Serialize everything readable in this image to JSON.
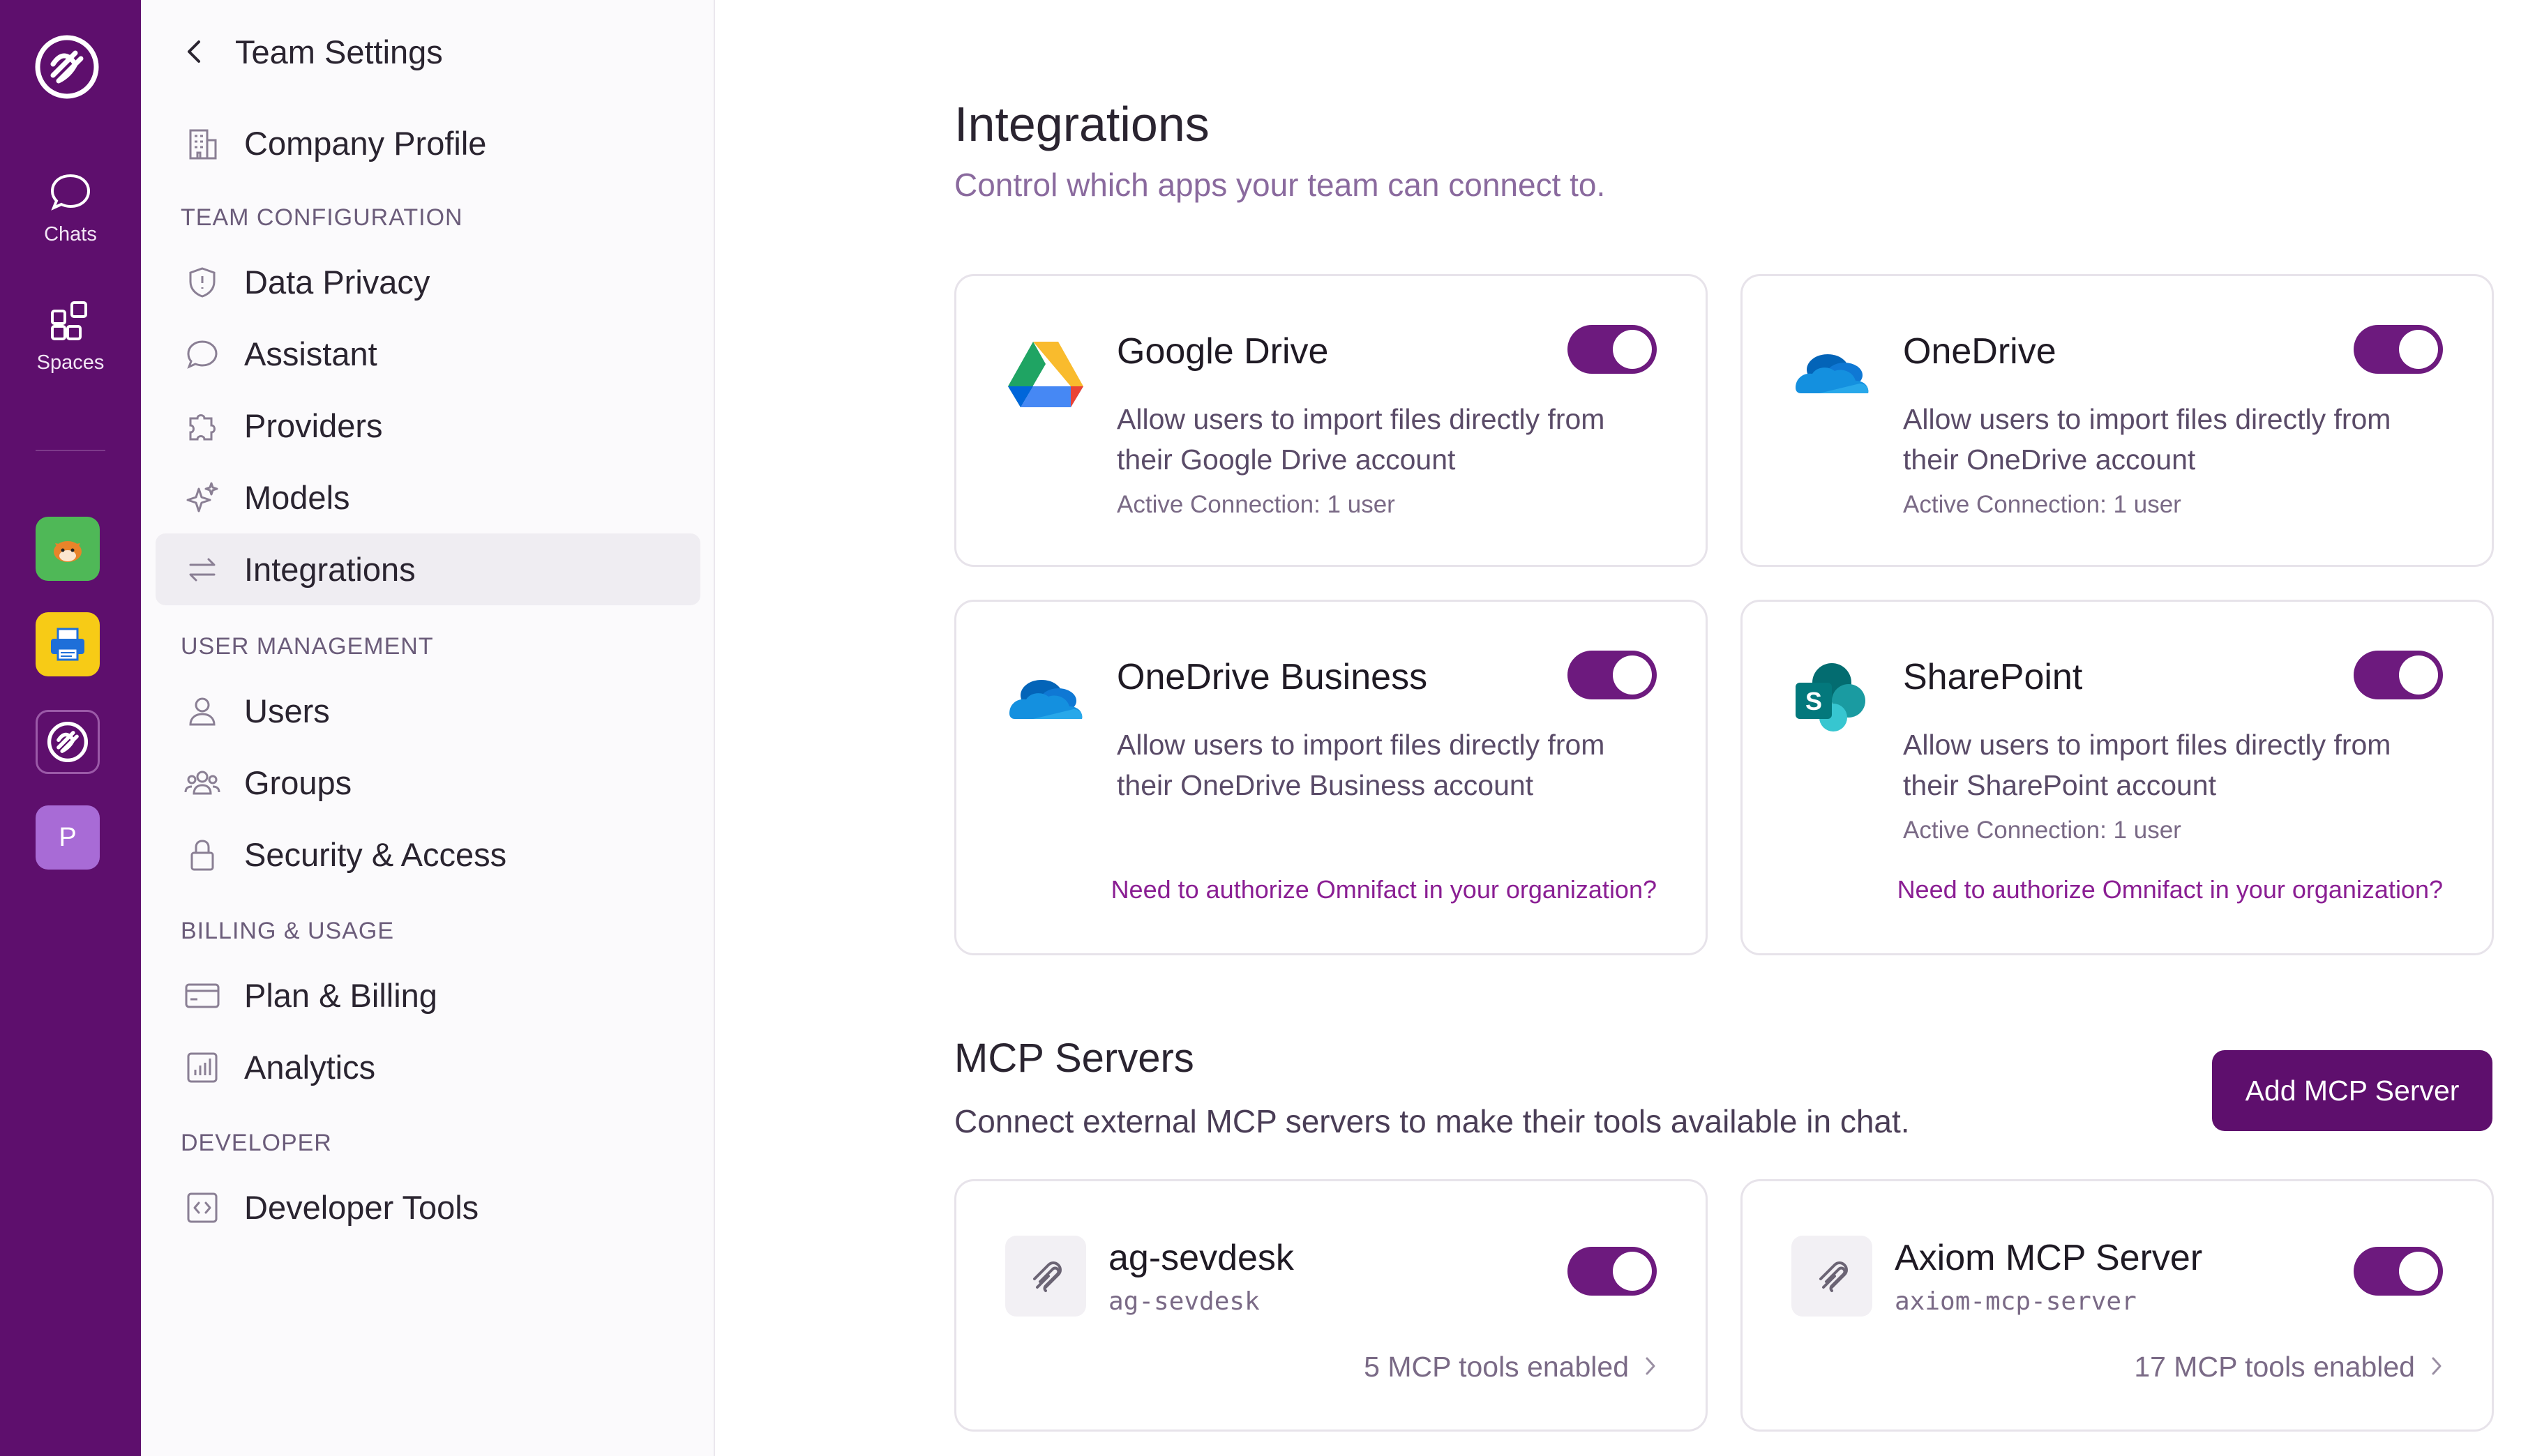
{
  "rail": {
    "items": [
      {
        "label": "Chats",
        "icon": "chat-bubble-icon"
      },
      {
        "label": "Spaces",
        "icon": "spaces-grid-icon"
      }
    ],
    "apps": [
      {
        "icon": "fox-app-icon",
        "color": "#4fb857"
      },
      {
        "icon": "printer-app-icon",
        "color": "#f7cb16"
      },
      {
        "icon": "omnifact-app-icon",
        "color": "#5e0f6d"
      },
      {
        "icon": "letter-avatar",
        "label": "P",
        "color": "#a86bd6"
      }
    ]
  },
  "sidebar": {
    "back_label": "Team Settings",
    "top_items": [
      {
        "label": "Company Profile",
        "icon": "building-icon"
      }
    ],
    "sections": [
      {
        "title": "TEAM CONFIGURATION",
        "items": [
          {
            "label": "Data Privacy",
            "icon": "shield-icon"
          },
          {
            "label": "Assistant",
            "icon": "chat-bubble-icon"
          },
          {
            "label": "Providers",
            "icon": "puzzle-icon"
          },
          {
            "label": "Models",
            "icon": "sparkles-icon"
          },
          {
            "label": "Integrations",
            "icon": "arrows-exchange-icon",
            "active": true
          }
        ]
      },
      {
        "title": "USER MANAGEMENT",
        "items": [
          {
            "label": "Users",
            "icon": "user-icon"
          },
          {
            "label": "Groups",
            "icon": "users-group-icon"
          },
          {
            "label": "Security & Access",
            "icon": "lock-icon"
          }
        ]
      },
      {
        "title": "BILLING & USAGE",
        "items": [
          {
            "label": "Plan & Billing",
            "icon": "credit-card-icon"
          },
          {
            "label": "Analytics",
            "icon": "chart-icon"
          }
        ]
      },
      {
        "title": "DEVELOPER",
        "items": [
          {
            "label": "Developer Tools",
            "icon": "code-icon"
          }
        ]
      }
    ]
  },
  "integrations": {
    "title": "Integrations",
    "subtitle": "Control which apps your team can connect to.",
    "cards": [
      {
        "name": "Google Drive",
        "desc": "Allow users to import files directly from their Google Drive account",
        "meta": "Active Connection: 1 user",
        "link": "",
        "enabled": true,
        "icon": "google-drive-icon"
      },
      {
        "name": "OneDrive",
        "desc": "Allow users to import files directly from their OneDrive account",
        "meta": "Active Connection: 1 user",
        "link": "",
        "enabled": true,
        "icon": "onedrive-icon"
      },
      {
        "name": "OneDrive Business",
        "desc": "Allow users to import files directly from their OneDrive Business account",
        "meta": "",
        "link": "Need to authorize Omnifact in your organization?",
        "enabled": true,
        "icon": "onedrive-business-icon"
      },
      {
        "name": "SharePoint",
        "desc": "Allow users to import files directly from their SharePoint account",
        "meta": "Active Connection: 1 user",
        "link": "Need to authorize Omnifact in your organization?",
        "enabled": true,
        "icon": "sharepoint-icon"
      }
    ]
  },
  "mcp": {
    "title": "MCP Servers",
    "subtitle": "Connect external MCP servers to make their tools available in chat.",
    "add_label": "Add MCP Server",
    "servers": [
      {
        "name": "ag-sevdesk",
        "slug": "ag-sevdesk",
        "tools": "5 MCP tools enabled",
        "enabled": true
      },
      {
        "name": "Axiom MCP Server",
        "slug": "axiom-mcp-server",
        "tools": "17 MCP tools enabled",
        "enabled": true
      }
    ]
  },
  "colors": {
    "brand": "#5e0f6d",
    "toggle_on": "#6d1a7e",
    "link": "#8a1e93"
  }
}
